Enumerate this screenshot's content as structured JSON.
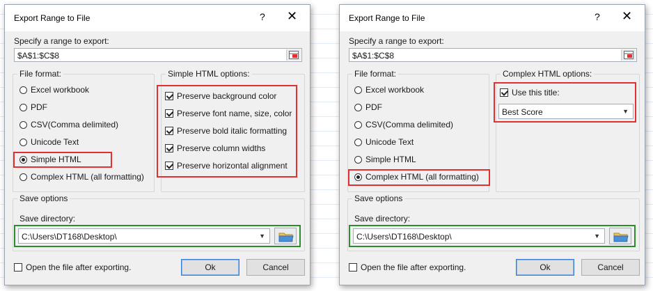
{
  "left": {
    "title": "Export Range to File",
    "help": "?",
    "close": "✕",
    "range_label": "Specify a range to export:",
    "range_value": "$A$1:$C$8",
    "file_format_title": "File format:",
    "formats": [
      "Excel workbook",
      "PDF",
      "CSV(Comma delimited)",
      "Unicode Text",
      "Simple HTML",
      "Complex HTML (all formatting)"
    ],
    "selected_format": "Simple HTML",
    "options_title": "Simple HTML options:",
    "options": [
      {
        "label": "Preserve background color",
        "checked": true
      },
      {
        "label": "Preserve font name, size, color",
        "checked": true
      },
      {
        "label": "Preserve bold italic formatting",
        "checked": true
      },
      {
        "label": "Preserve column widths",
        "checked": true
      },
      {
        "label": "Preserve horizontal alignment",
        "checked": true
      }
    ],
    "save_options_title": "Save options",
    "save_dir_label": "Save directory:",
    "save_dir_value": "C:\\Users\\DT168\\Desktop\\",
    "open_after_label": "Open the file after exporting.",
    "ok": "Ok",
    "cancel": "Cancel"
  },
  "right": {
    "title": "Export Range to File",
    "help": "?",
    "close": "✕",
    "range_label": "Specify a range to export:",
    "range_value": "$A$1:$C$8",
    "file_format_title": "File format:",
    "formats": [
      "Excel workbook",
      "PDF",
      "CSV(Comma delimited)",
      "Unicode Text",
      "Simple HTML",
      "Complex HTML (all formatting)"
    ],
    "selected_format": "Complex HTML (all formatting)",
    "options_title": "Complex HTML options:",
    "use_title_label": "Use this title:",
    "use_title_checked": true,
    "title_value": "Best Score",
    "save_options_title": "Save options",
    "save_dir_label": "Save directory:",
    "save_dir_value": "C:\\Users\\DT168\\Desktop\\",
    "open_after_label": "Open the file after exporting.",
    "ok": "Ok",
    "cancel": "Cancel"
  },
  "colors": {
    "highlight_red": "#e03030",
    "highlight_green": "#2e8b2e",
    "dialog_bg": "#f0f0f0",
    "primary_border": "#3b7ed1"
  }
}
